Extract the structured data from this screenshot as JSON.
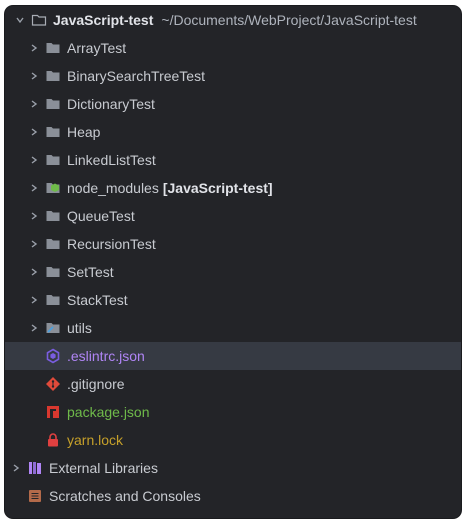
{
  "project": {
    "name": "JavaScript-test",
    "path": "~/Documents/WebProject/JavaScript-test"
  },
  "folders": [
    {
      "label": "ArrayTest",
      "icon": "folder-icon"
    },
    {
      "label": "BinarySearchTreeTest",
      "icon": "folder-icon"
    },
    {
      "label": "DictionaryTest",
      "icon": "folder-icon"
    },
    {
      "label": "Heap",
      "icon": "folder-icon"
    },
    {
      "label": "LinkedListTest",
      "icon": "folder-icon"
    },
    {
      "label": "node_modules",
      "suffix": "[JavaScript-test]",
      "icon": "node-modules-folder-icon"
    },
    {
      "label": "QueueTest",
      "icon": "folder-icon"
    },
    {
      "label": "RecursionTest",
      "icon": "folder-icon"
    },
    {
      "label": "SetTest",
      "icon": "folder-icon"
    },
    {
      "label": "StackTest",
      "icon": "folder-icon"
    },
    {
      "label": "utils",
      "icon": "folder-icon"
    }
  ],
  "files": [
    {
      "label": ".eslintrc.json",
      "icon": "eslint-icon",
      "color": "#b085f5"
    },
    {
      "label": ".gitignore",
      "icon": "git-icon",
      "color": "#c8cbd1"
    },
    {
      "label": "package.json",
      "icon": "npm-icon",
      "color": "#6fba4a"
    },
    {
      "label": "yarn.lock",
      "icon": "lock-icon",
      "color": "#c6a02a"
    }
  ],
  "external_libraries": {
    "label": "External Libraries"
  },
  "scratches": {
    "label": "Scratches and Consoles"
  },
  "colors": {
    "background": "#232428",
    "selection": "#363a43",
    "text": "#c8cbd1",
    "folder": "#8a8f98",
    "node_modules": "#6fba4a",
    "eslint": "#7a5de0",
    "git": "#e04a3a",
    "npm": "#d8382f",
    "lock": "#e04040"
  }
}
